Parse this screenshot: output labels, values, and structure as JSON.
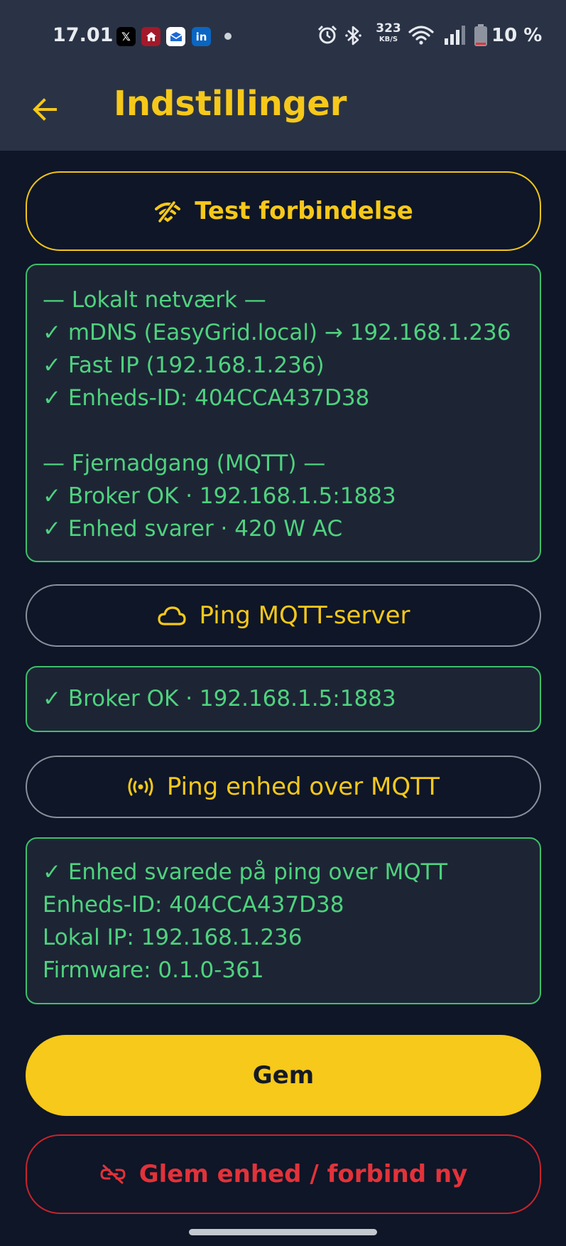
{
  "status_bar": {
    "time": "17.01",
    "notifications": [
      "x-icon",
      "home-app-icon",
      "mail-app-icon",
      "linkedin-icon"
    ],
    "net_speed_value": "323",
    "net_speed_unit": "KB/S",
    "battery": "10 %"
  },
  "app_bar": {
    "title": "Indstillinger"
  },
  "test_button": {
    "label": "Test forbindelse",
    "icon": "wifi-signal-icon"
  },
  "test_result": {
    "lines": [
      "— Lokalt netværk —",
      "✓ mDNS (EasyGrid.local) → 192.168.1.236",
      "✓ Fast IP (192.168.1.236)",
      "✓ Enheds-ID: 404CCA437D38",
      "",
      "— Fjernadgang (MQTT) —",
      "✓ Broker OK · 192.168.1.5:1883",
      "✓ Enhed svarer · 420 W AC"
    ]
  },
  "ping_server_button": {
    "label": "Ping MQTT-server",
    "icon": "cloud-icon"
  },
  "ping_server_result": {
    "lines": [
      "✓ Broker OK · 192.168.1.5:1883"
    ]
  },
  "ping_device_button": {
    "label": "Ping enhed over MQTT",
    "icon": "broadcast-icon"
  },
  "ping_device_result": {
    "lines": [
      "✓ Enhed svarede på ping over MQTT",
      "Enheds-ID: 404CCA437D38",
      "Lokal IP: 192.168.1.236",
      "Firmware: 0.1.0-361"
    ]
  },
  "save_button": {
    "label": "Gem"
  },
  "forget_button": {
    "label": "Glem enhed / forbind ny",
    "icon": "link-off-icon"
  },
  "colors": {
    "background": "#0e1627",
    "appbar": "#2a3345",
    "accent": "#f6c81a",
    "success": "#4fd27e",
    "danger": "#e2323a"
  }
}
